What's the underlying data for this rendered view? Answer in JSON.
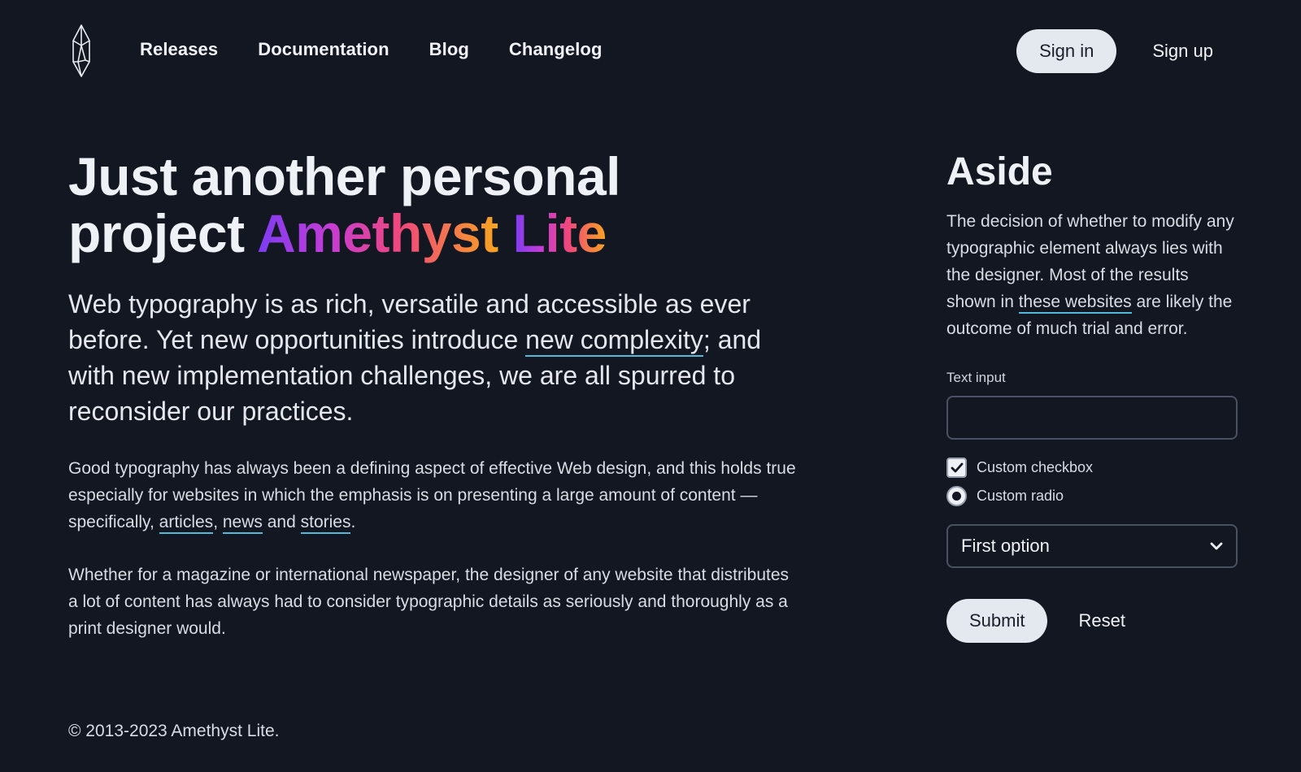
{
  "nav": {
    "items": [
      "Releases",
      "Documentation",
      "Blog",
      "Changelog"
    ],
    "sign_in": "Sign in",
    "sign_up": "Sign up"
  },
  "hero": {
    "title_line1": "Just another personal",
    "title_line2": "project",
    "brand_part1": "Amethyst",
    "brand_part2": "Lite",
    "lead_before": "Web typography is as rich, versatile and accessible as ever before. Yet new opportunities introduce ",
    "lead_link": "new complexity",
    "lead_after": "; and with new implementation challenges, we are all spurred to reconsider our practices."
  },
  "body": {
    "p1_before": "Good typography has always been a defining aspect of effective Web design, and this holds true especially for websites in which the emphasis is on presenting a large amount of content — specifically, ",
    "p1_link1": "articles",
    "p1_sep1": ", ",
    "p1_link2": "news",
    "p1_sep2": " and ",
    "p1_link3": "stories",
    "p1_end": ".",
    "p2": "Whether for a magazine or international newspaper, the designer of any website that distributes a lot of content has always had to consider typographic details as seriously and thoroughly as a print designer would."
  },
  "footer": {
    "copyright": "© 2013-2023 Amethyst Lite."
  },
  "aside": {
    "title": "Aside",
    "text_before": "The decision of whether to modify any typographic element always lies with the designer. Most of the results shown in ",
    "text_link": "these websites",
    "text_after": " are likely the outcome of much trial and error.",
    "input_label": "Text input",
    "input_value": "",
    "checkbox_label": "Custom checkbox",
    "checkbox_checked": true,
    "radio_label": "Custom radio",
    "radio_selected": true,
    "select_value": "First option",
    "submit": "Submit",
    "reset": "Reset"
  },
  "colors": {
    "background": "#131722",
    "link_underline": "#52b9d8",
    "gradient": [
      "#7b3cf2",
      "#c53cd6",
      "#f0487a",
      "#f7a520"
    ]
  }
}
